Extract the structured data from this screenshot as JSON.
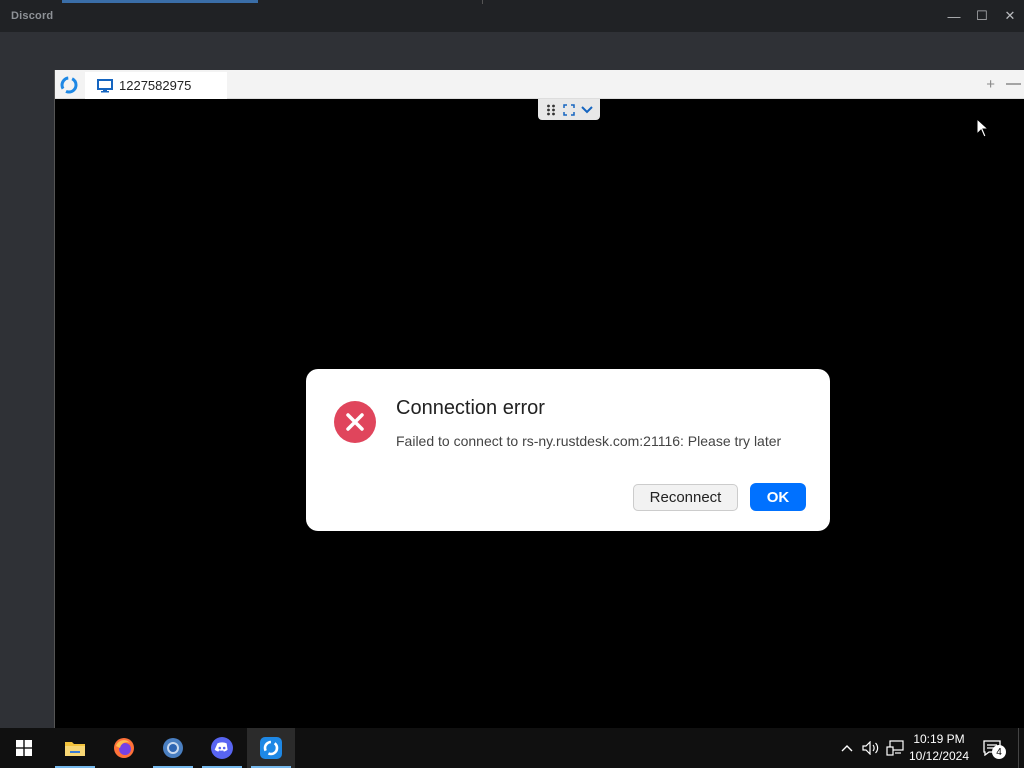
{
  "discord": {
    "title": "Discord",
    "minimize": "—",
    "maximize": "☐",
    "close": "✕"
  },
  "rustdesk": {
    "tab_label": "1227582975",
    "add_tab": "+",
    "minimize": "—"
  },
  "dialog": {
    "title": "Connection error",
    "message": "Failed to connect to rs-ny.rustdesk.com:21116: Please try later",
    "reconnect_label": "Reconnect",
    "ok_label": "OK",
    "icon": "error-icon",
    "icon_color": "#e0455c",
    "ok_color": "#0071ff"
  },
  "taskbar": {
    "apps": [
      {
        "name": "start",
        "icon": "windows-icon"
      },
      {
        "name": "file-explorer",
        "icon": "folder-icon"
      },
      {
        "name": "firefox",
        "icon": "firefox-icon"
      },
      {
        "name": "chrome",
        "icon": "chrome-icon"
      },
      {
        "name": "discord",
        "icon": "discord-icon"
      },
      {
        "name": "rustdesk",
        "icon": "rustdesk-icon"
      }
    ],
    "time": "10:19 PM",
    "date": "10/12/2024",
    "notification_count": "4"
  }
}
